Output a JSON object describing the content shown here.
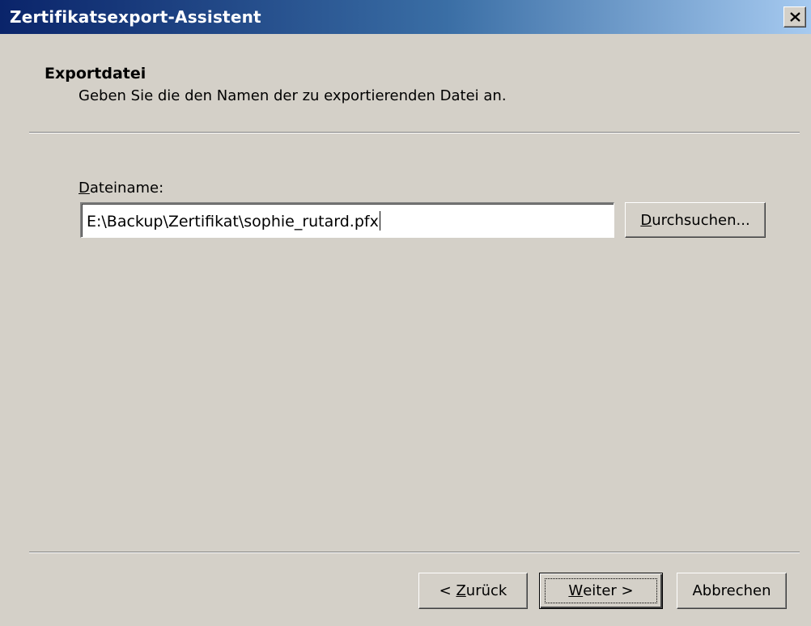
{
  "window": {
    "title": "Zertifikatsexport-Assistent"
  },
  "header": {
    "title": "Exportdatei",
    "subtitle": "Geben Sie die den Namen der zu exportierenden Datei an."
  },
  "form": {
    "filename_label_access_key": "D",
    "filename_label_rest": "ateiname:",
    "filename_value": "E:\\Backup\\Zertifikat\\sophie_rutard.pfx",
    "browse": {
      "access_key": "D",
      "rest": "urchsuchen..."
    }
  },
  "footer": {
    "back": {
      "prefix": "< ",
      "access_key": "Z",
      "rest": "urück"
    },
    "next": {
      "access_key": "W",
      "rest": "eiter >"
    },
    "cancel": "Abbrechen"
  },
  "icons": {
    "close": "close-icon"
  },
  "colors": {
    "dialog_bg": "#d4d0c8",
    "titlebar_start": "#0a246a",
    "titlebar_end": "#a6caf0",
    "title_text": "#ffffff"
  }
}
